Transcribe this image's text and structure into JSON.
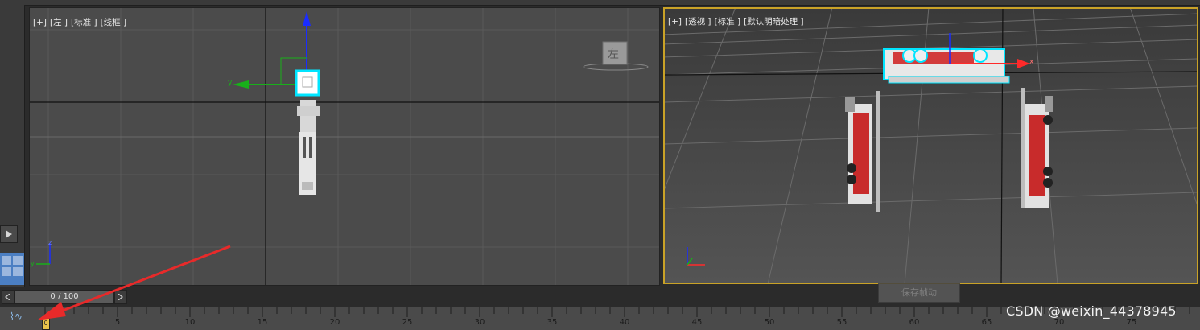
{
  "viewports": {
    "left": {
      "labels": [
        "[+]",
        "[左 ]",
        "[标准 ]",
        "[线框 ]"
      ],
      "viewcube_label": "左",
      "axis_y": "y",
      "axis_z": "z"
    },
    "perspective": {
      "labels": [
        "[+]",
        "[透视 ]",
        "[标准 ]",
        "[默认明暗处理 ]"
      ],
      "axis_x": "x"
    }
  },
  "timeline": {
    "frame_counter": "0 / 100",
    "ticks": [
      "5",
      "10",
      "15",
      "20",
      "25",
      "30",
      "35",
      "40",
      "45",
      "50",
      "55",
      "60",
      "65",
      "70",
      "75"
    ],
    "current_frame": 0,
    "max_frame": 100,
    "marker_label": "0"
  },
  "save_button": {
    "label": "保存帧动"
  },
  "watermark": "CSDN @weixin_44378945",
  "icons": [
    "play-icon",
    "viewport-layout-icon",
    "chevron-left-icon",
    "chevron-right-icon",
    "function-curve-icon",
    "red-annotation-arrow"
  ],
  "colors": {
    "accent_border": "#c9a227",
    "selection": "#00e5ff",
    "axis_x": "#ff2a2a",
    "axis_y": "#18b01a",
    "axis_z": "#1a2cff",
    "arrow": "#e82a2a"
  }
}
